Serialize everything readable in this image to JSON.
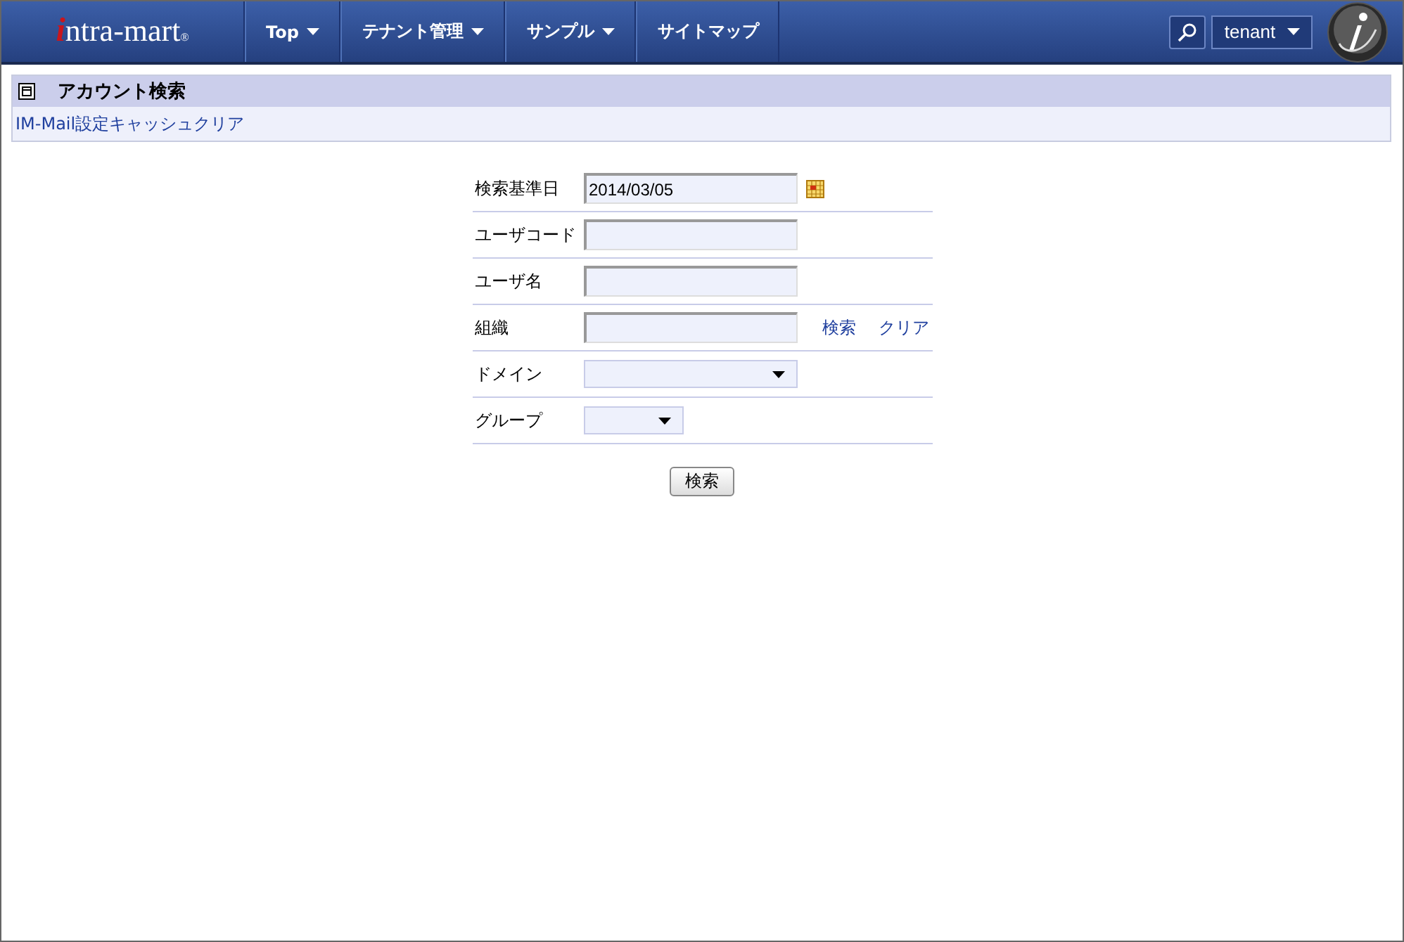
{
  "header": {
    "logo": {
      "text": "intra-mart",
      "mark": "®"
    },
    "menu": [
      {
        "label": "Top",
        "dropdown": true
      },
      {
        "label": "テナント管理",
        "dropdown": true
      },
      {
        "label": "サンプル",
        "dropdown": true
      },
      {
        "label": "サイトマップ",
        "dropdown": false
      }
    ],
    "user_menu": {
      "label": "tenant"
    }
  },
  "section": {
    "title": "アカウント検索",
    "links": [
      "IM-Mail設定キャッシュクリア"
    ]
  },
  "form": {
    "rows": [
      {
        "kind": "date",
        "label": "検索基準日",
        "value": "2014/03/05"
      },
      {
        "kind": "text",
        "label": "ユーザコード"
      },
      {
        "kind": "text",
        "label": "ユーザ名"
      },
      {
        "kind": "lookup",
        "label": "組織",
        "links": [
          "検索",
          "クリア"
        ]
      },
      {
        "kind": "select",
        "label": "ドメイン"
      },
      {
        "kind": "select_short",
        "label": "グループ"
      }
    ],
    "submit": "検索"
  }
}
